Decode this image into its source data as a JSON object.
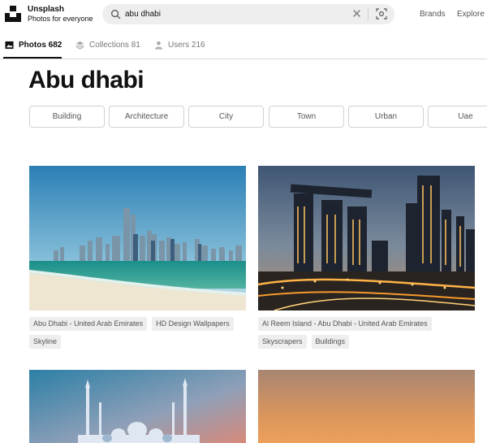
{
  "header": {
    "brand_name": "Unsplash",
    "brand_tagline": "Photos for everyone",
    "search_value": "abu dhabi",
    "nav": {
      "brands": "Brands",
      "explore": "Explore"
    }
  },
  "tabs": [
    {
      "label": "Photos 682",
      "icon": "photo-icon",
      "active": true
    },
    {
      "label": "Collections 81",
      "icon": "collections-icon",
      "active": false
    },
    {
      "label": "Users 216",
      "icon": "users-icon",
      "active": false
    }
  ],
  "page_title": "Abu dhabi",
  "related_tags": [
    "Building",
    "Architecture",
    "City",
    "Town",
    "Urban",
    "Uae"
  ],
  "photos": [
    {
      "tags": [
        "Abu Dhabi - United Arab Emirates",
        "HD Design Wallpapers",
        "Skyline"
      ]
    },
    {
      "tags": [
        "Al Reem Island - Abu Dhabi - United Arab Emirates",
        "Skyscrapers",
        "Buildings"
      ]
    },
    {
      "tags": []
    },
    {
      "tags": []
    }
  ],
  "colors": {
    "accent": "#111111",
    "chip_border": "#d1d1d1",
    "tag_bg": "#eeeeee"
  }
}
